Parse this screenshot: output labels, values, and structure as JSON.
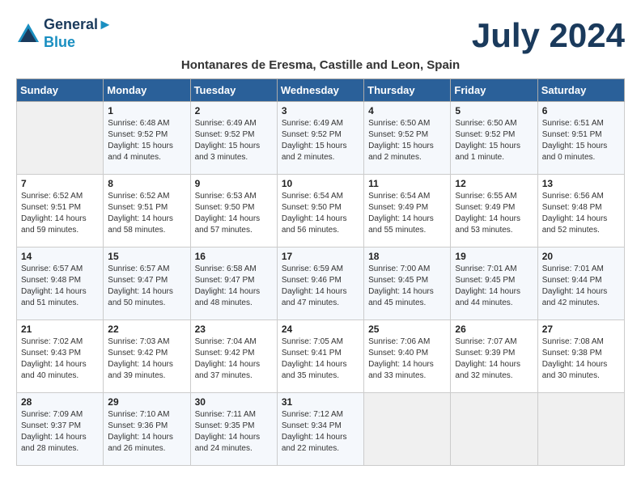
{
  "header": {
    "logo_line1": "General",
    "logo_line2": "Blue",
    "month_title": "July 2024",
    "location": "Hontanares de Eresma, Castille and Leon, Spain"
  },
  "weekdays": [
    "Sunday",
    "Monday",
    "Tuesday",
    "Wednesday",
    "Thursday",
    "Friday",
    "Saturday"
  ],
  "weeks": [
    [
      {
        "day": "",
        "sunrise": "",
        "sunset": "",
        "daylight": ""
      },
      {
        "day": "1",
        "sunrise": "Sunrise: 6:48 AM",
        "sunset": "Sunset: 9:52 PM",
        "daylight": "Daylight: 15 hours and 4 minutes."
      },
      {
        "day": "2",
        "sunrise": "Sunrise: 6:49 AM",
        "sunset": "Sunset: 9:52 PM",
        "daylight": "Daylight: 15 hours and 3 minutes."
      },
      {
        "day": "3",
        "sunrise": "Sunrise: 6:49 AM",
        "sunset": "Sunset: 9:52 PM",
        "daylight": "Daylight: 15 hours and 2 minutes."
      },
      {
        "day": "4",
        "sunrise": "Sunrise: 6:50 AM",
        "sunset": "Sunset: 9:52 PM",
        "daylight": "Daylight: 15 hours and 2 minutes."
      },
      {
        "day": "5",
        "sunrise": "Sunrise: 6:50 AM",
        "sunset": "Sunset: 9:52 PM",
        "daylight": "Daylight: 15 hours and 1 minute."
      },
      {
        "day": "6",
        "sunrise": "Sunrise: 6:51 AM",
        "sunset": "Sunset: 9:51 PM",
        "daylight": "Daylight: 15 hours and 0 minutes."
      }
    ],
    [
      {
        "day": "7",
        "sunrise": "Sunrise: 6:52 AM",
        "sunset": "Sunset: 9:51 PM",
        "daylight": "Daylight: 14 hours and 59 minutes."
      },
      {
        "day": "8",
        "sunrise": "Sunrise: 6:52 AM",
        "sunset": "Sunset: 9:51 PM",
        "daylight": "Daylight: 14 hours and 58 minutes."
      },
      {
        "day": "9",
        "sunrise": "Sunrise: 6:53 AM",
        "sunset": "Sunset: 9:50 PM",
        "daylight": "Daylight: 14 hours and 57 minutes."
      },
      {
        "day": "10",
        "sunrise": "Sunrise: 6:54 AM",
        "sunset": "Sunset: 9:50 PM",
        "daylight": "Daylight: 14 hours and 56 minutes."
      },
      {
        "day": "11",
        "sunrise": "Sunrise: 6:54 AM",
        "sunset": "Sunset: 9:49 PM",
        "daylight": "Daylight: 14 hours and 55 minutes."
      },
      {
        "day": "12",
        "sunrise": "Sunrise: 6:55 AM",
        "sunset": "Sunset: 9:49 PM",
        "daylight": "Daylight: 14 hours and 53 minutes."
      },
      {
        "day": "13",
        "sunrise": "Sunrise: 6:56 AM",
        "sunset": "Sunset: 9:48 PM",
        "daylight": "Daylight: 14 hours and 52 minutes."
      }
    ],
    [
      {
        "day": "14",
        "sunrise": "Sunrise: 6:57 AM",
        "sunset": "Sunset: 9:48 PM",
        "daylight": "Daylight: 14 hours and 51 minutes."
      },
      {
        "day": "15",
        "sunrise": "Sunrise: 6:57 AM",
        "sunset": "Sunset: 9:47 PM",
        "daylight": "Daylight: 14 hours and 50 minutes."
      },
      {
        "day": "16",
        "sunrise": "Sunrise: 6:58 AM",
        "sunset": "Sunset: 9:47 PM",
        "daylight": "Daylight: 14 hours and 48 minutes."
      },
      {
        "day": "17",
        "sunrise": "Sunrise: 6:59 AM",
        "sunset": "Sunset: 9:46 PM",
        "daylight": "Daylight: 14 hours and 47 minutes."
      },
      {
        "day": "18",
        "sunrise": "Sunrise: 7:00 AM",
        "sunset": "Sunset: 9:45 PM",
        "daylight": "Daylight: 14 hours and 45 minutes."
      },
      {
        "day": "19",
        "sunrise": "Sunrise: 7:01 AM",
        "sunset": "Sunset: 9:45 PM",
        "daylight": "Daylight: 14 hours and 44 minutes."
      },
      {
        "day": "20",
        "sunrise": "Sunrise: 7:01 AM",
        "sunset": "Sunset: 9:44 PM",
        "daylight": "Daylight: 14 hours and 42 minutes."
      }
    ],
    [
      {
        "day": "21",
        "sunrise": "Sunrise: 7:02 AM",
        "sunset": "Sunset: 9:43 PM",
        "daylight": "Daylight: 14 hours and 40 minutes."
      },
      {
        "day": "22",
        "sunrise": "Sunrise: 7:03 AM",
        "sunset": "Sunset: 9:42 PM",
        "daylight": "Daylight: 14 hours and 39 minutes."
      },
      {
        "day": "23",
        "sunrise": "Sunrise: 7:04 AM",
        "sunset": "Sunset: 9:42 PM",
        "daylight": "Daylight: 14 hours and 37 minutes."
      },
      {
        "day": "24",
        "sunrise": "Sunrise: 7:05 AM",
        "sunset": "Sunset: 9:41 PM",
        "daylight": "Daylight: 14 hours and 35 minutes."
      },
      {
        "day": "25",
        "sunrise": "Sunrise: 7:06 AM",
        "sunset": "Sunset: 9:40 PM",
        "daylight": "Daylight: 14 hours and 33 minutes."
      },
      {
        "day": "26",
        "sunrise": "Sunrise: 7:07 AM",
        "sunset": "Sunset: 9:39 PM",
        "daylight": "Daylight: 14 hours and 32 minutes."
      },
      {
        "day": "27",
        "sunrise": "Sunrise: 7:08 AM",
        "sunset": "Sunset: 9:38 PM",
        "daylight": "Daylight: 14 hours and 30 minutes."
      }
    ],
    [
      {
        "day": "28",
        "sunrise": "Sunrise: 7:09 AM",
        "sunset": "Sunset: 9:37 PM",
        "daylight": "Daylight: 14 hours and 28 minutes."
      },
      {
        "day": "29",
        "sunrise": "Sunrise: 7:10 AM",
        "sunset": "Sunset: 9:36 PM",
        "daylight": "Daylight: 14 hours and 26 minutes."
      },
      {
        "day": "30",
        "sunrise": "Sunrise: 7:11 AM",
        "sunset": "Sunset: 9:35 PM",
        "daylight": "Daylight: 14 hours and 24 minutes."
      },
      {
        "day": "31",
        "sunrise": "Sunrise: 7:12 AM",
        "sunset": "Sunset: 9:34 PM",
        "daylight": "Daylight: 14 hours and 22 minutes."
      },
      {
        "day": "",
        "sunrise": "",
        "sunset": "",
        "daylight": ""
      },
      {
        "day": "",
        "sunrise": "",
        "sunset": "",
        "daylight": ""
      },
      {
        "day": "",
        "sunrise": "",
        "sunset": "",
        "daylight": ""
      }
    ]
  ]
}
